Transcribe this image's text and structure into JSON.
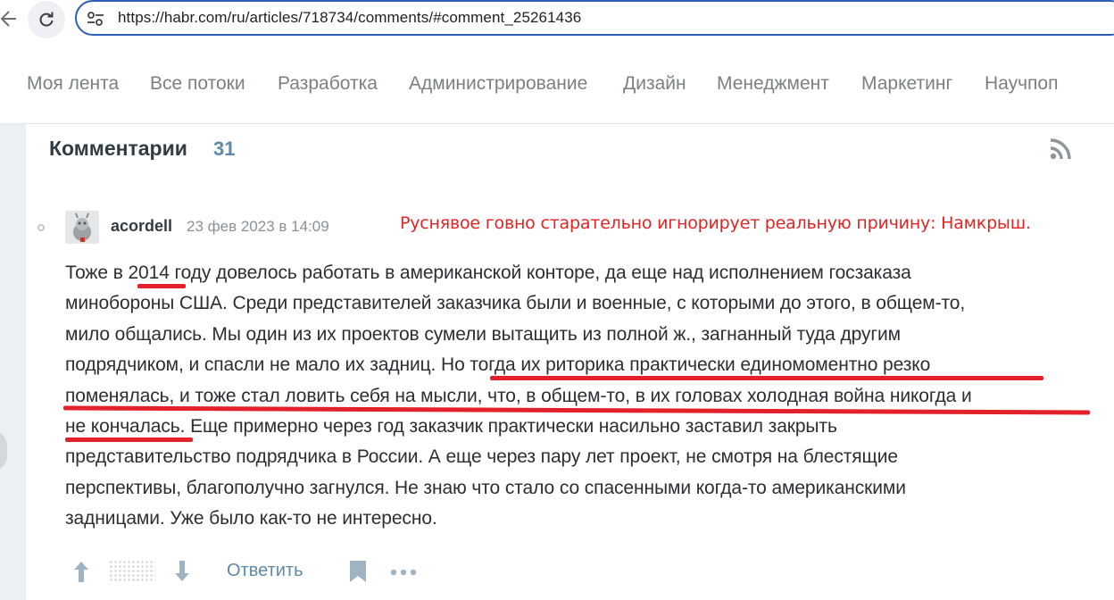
{
  "browser": {
    "url": "https://habr.com/ru/articles/718734/comments/#comment_25261436"
  },
  "topnav": {
    "items": [
      "Моя лента",
      "Все потоки",
      "Разработка",
      "Администрирование",
      "Дизайн",
      "Менеджмент",
      "Маркетинг",
      "Научпоп"
    ]
  },
  "comments": {
    "title": "Комментарии",
    "count": "31"
  },
  "comment": {
    "username": "acordell",
    "date": "23 фев 2023 в 14:09",
    "annotation": "Руснявое говно старательно игнорирует реальную причину: Намкрыш.",
    "lines": [
      "Тоже в 2014 году довелось работать в американской конторе, да еще над исполнением госзаказа",
      "минобороны США. Среди представителей заказчика были и военные, с которыми до этого, в общем-то,",
      "мило общались. Мы один из их проектов сумели вытащить из полной ж., загнанный туда другим",
      "подрядчиком, и спасли не мало их задниц. Но тогда их риторика практически единомоментно резко",
      "поменялась, и тоже стал ловить себя на мысли, что, в общем-то, в их головах холодная война никогда и",
      "не кончалась. Еще примерно через год заказчик практически насильно заставил закрыть",
      "представительство подрядчика в России. А еще через пару лет проект, не смотря на блестящие",
      "перспективы, благополучно загнулся. Не знаю что стало со спасенными когда-то американскими",
      "задницами. Уже было как-то не интересно."
    ],
    "reply_label": "Ответить"
  },
  "colors": {
    "accent": "#5e8aa8",
    "annotation_red": "#e32424",
    "url_border": "#2b5fb8"
  }
}
